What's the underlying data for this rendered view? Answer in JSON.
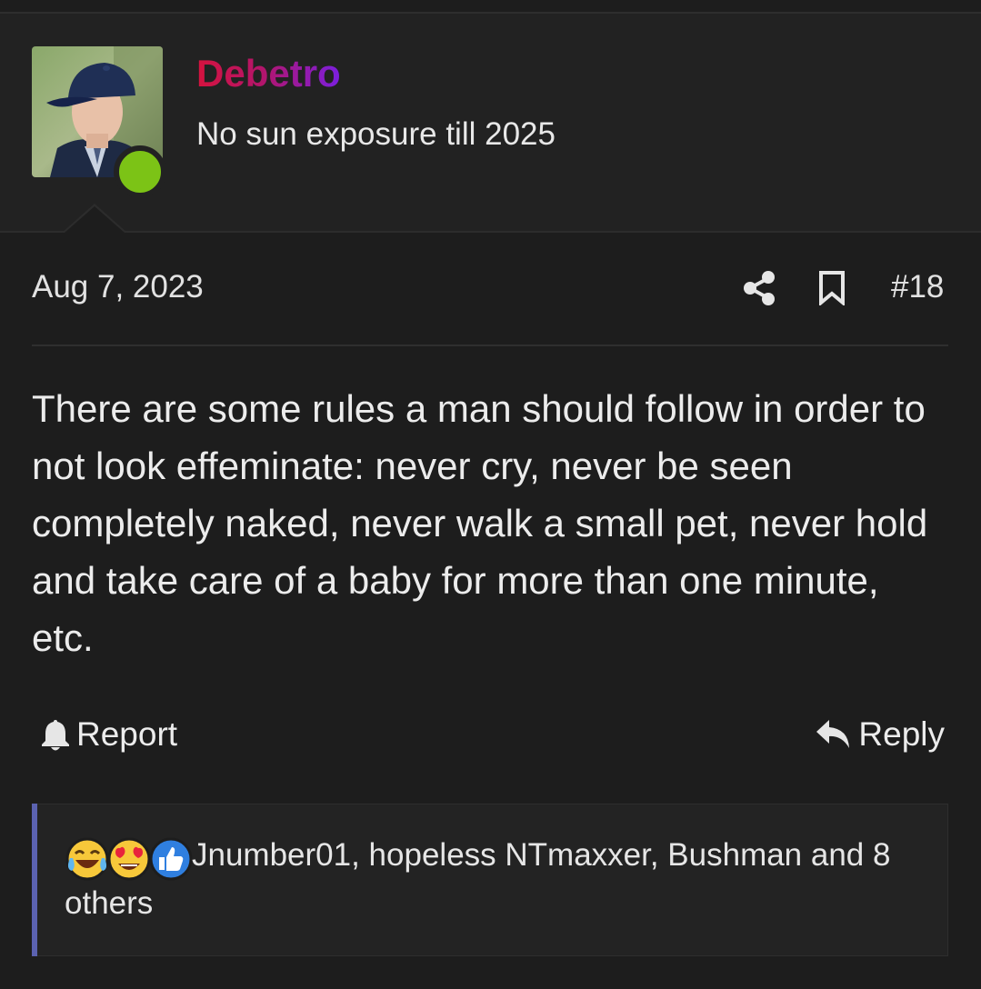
{
  "user": {
    "username": "Debetro",
    "user_title": "No sun exposure till 2025",
    "online": true,
    "username_gradient": [
      "#d5133e",
      "#7b1fe0"
    ]
  },
  "post": {
    "date": "Aug 7, 2023",
    "number": "#18",
    "body": "There are some rules a man should follow in order to not look effeminate: never cry, never be seen completely naked, never walk a small pet, never hold and take care of a baby for more than one minute, etc."
  },
  "actions": {
    "report_label": "Report",
    "reply_label": "Reply",
    "share_icon": "share-icon",
    "bookmark_icon": "bookmark-icon"
  },
  "reactions": {
    "icons": [
      "laughing-crying-emoji",
      "heart-eyes-emoji",
      "thumbs-up-icon"
    ],
    "text": "Jnumber01, hopeless NTmaxxer, Bushman and 8 others"
  },
  "colors": {
    "background": "#1d1d1d",
    "online_green": "#7cc316",
    "reaction_accent": "#5b62b0"
  }
}
